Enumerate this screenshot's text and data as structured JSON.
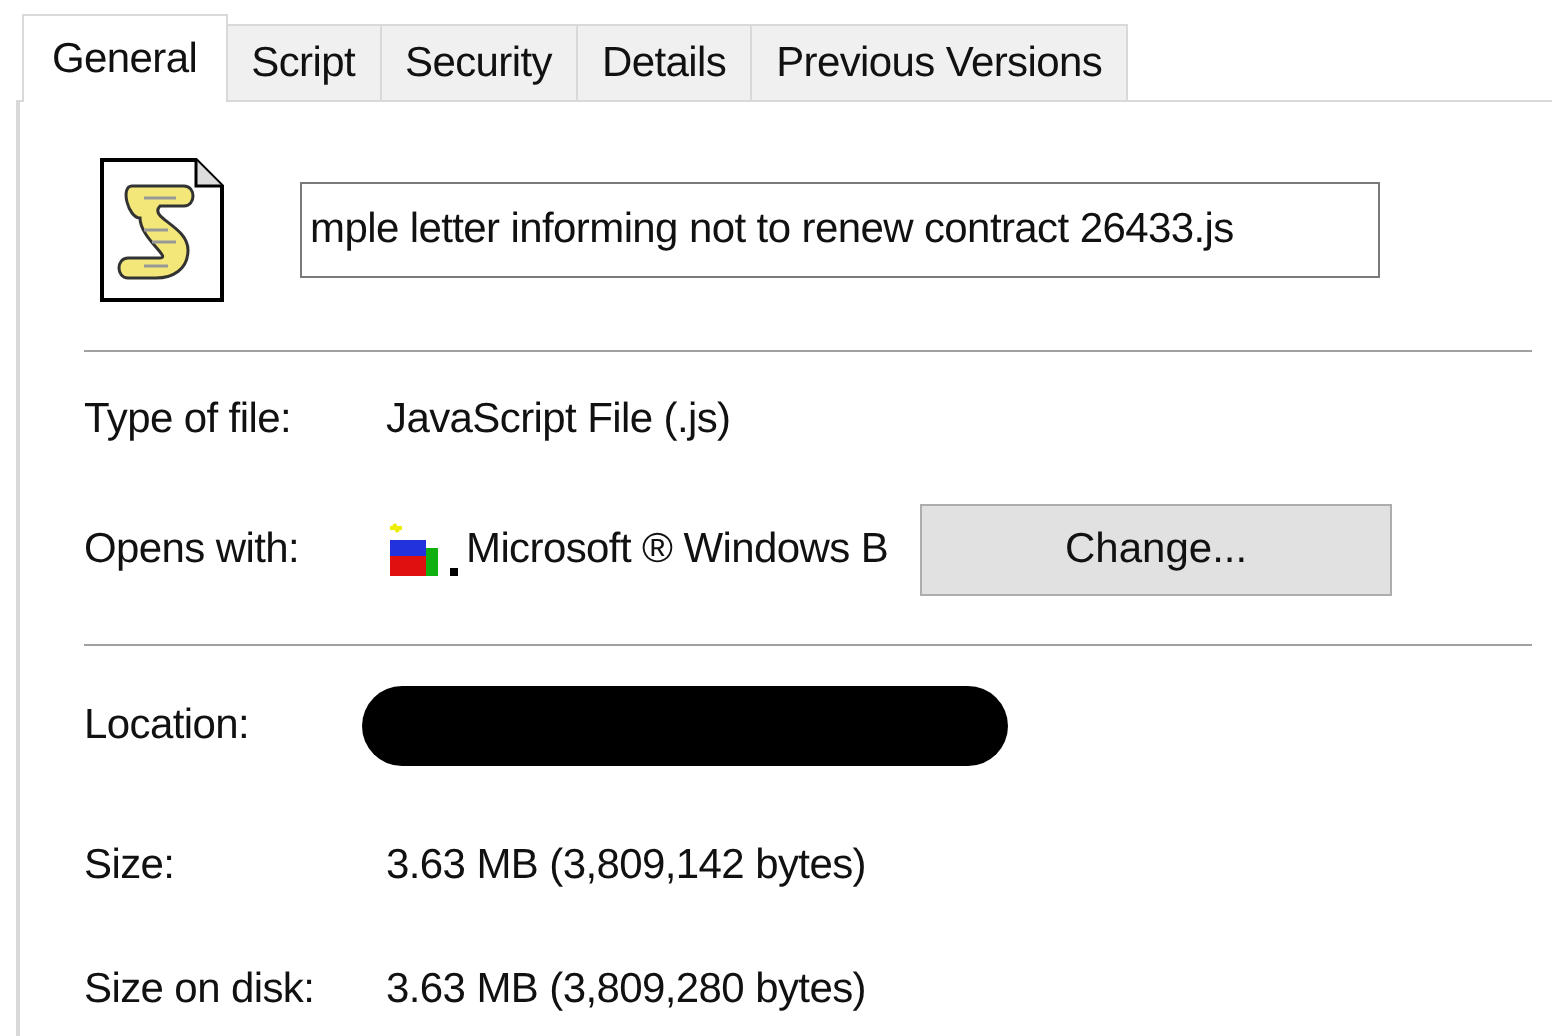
{
  "tabs": [
    {
      "label": "General",
      "selected": true
    },
    {
      "label": "Script",
      "selected": false
    },
    {
      "label": "Security",
      "selected": false
    },
    {
      "label": "Details",
      "selected": false
    },
    {
      "label": "Previous Versions",
      "selected": false
    }
  ],
  "file_name": {
    "value": "mple letter informing not to renew contract 26433.js"
  },
  "type_of_file": {
    "label": "Type of file:",
    "value": "JavaScript File (.js)"
  },
  "opens_with": {
    "label": "Opens with:",
    "value": "Microsoft ® Windows B",
    "button": "Change..."
  },
  "location": {
    "label": "Location:",
    "redacted": true
  },
  "size": {
    "label": "Size:",
    "value": "3.63 MB (3,809,142 bytes)"
  },
  "size_on_disk": {
    "label": "Size on disk:",
    "value": "3.63 MB (3,809,280 bytes)"
  }
}
